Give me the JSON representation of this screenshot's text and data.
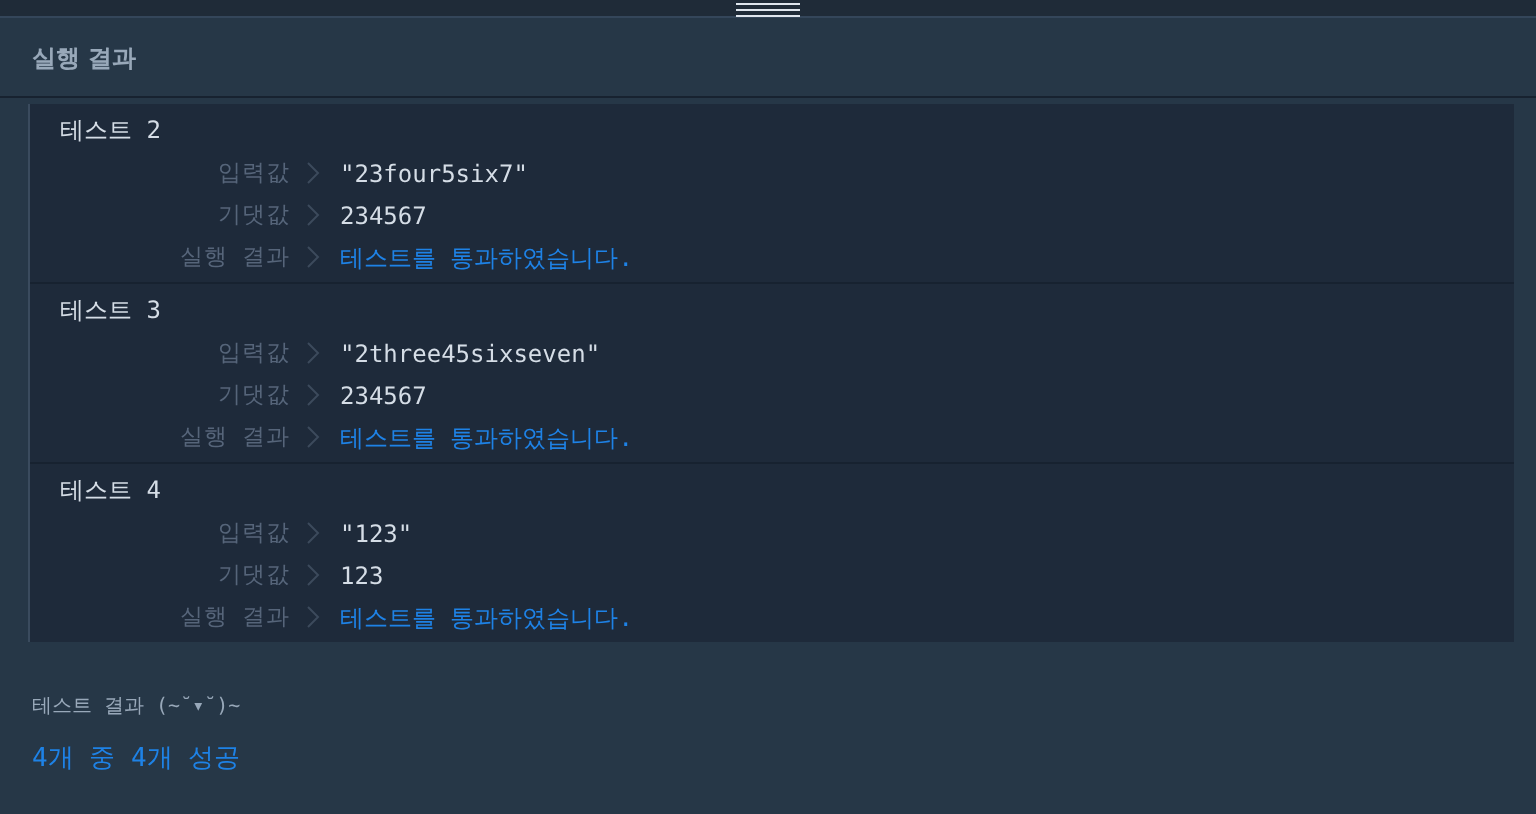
{
  "panel": {
    "title": "실행 결과"
  },
  "tests": [
    {
      "title": "테스트 2",
      "rows": [
        {
          "label": "입력값",
          "value": "\"23four5six7\"",
          "kind": "plain"
        },
        {
          "label": "기댓값",
          "value": "234567",
          "kind": "plain"
        },
        {
          "label": "실행 결과",
          "value": "테스트를 통과하였습니다.",
          "kind": "pass"
        }
      ]
    },
    {
      "title": "테스트 3",
      "rows": [
        {
          "label": "입력값",
          "value": "\"2three45sixseven\"",
          "kind": "plain"
        },
        {
          "label": "기댓값",
          "value": "234567",
          "kind": "plain"
        },
        {
          "label": "실행 결과",
          "value": "테스트를 통과하였습니다.",
          "kind": "pass"
        }
      ]
    },
    {
      "title": "테스트 4",
      "rows": [
        {
          "label": "입력값",
          "value": "\"123\"",
          "kind": "plain"
        },
        {
          "label": "기댓값",
          "value": "123",
          "kind": "plain"
        },
        {
          "label": "실행 결과",
          "value": "테스트를 통과하였습니다.",
          "kind": "pass"
        }
      ]
    }
  ],
  "summary": {
    "heading": "테스트 결과 (~˘▾˘)~",
    "result": "4개 중 4개 성공",
    "kind": "pass"
  }
}
